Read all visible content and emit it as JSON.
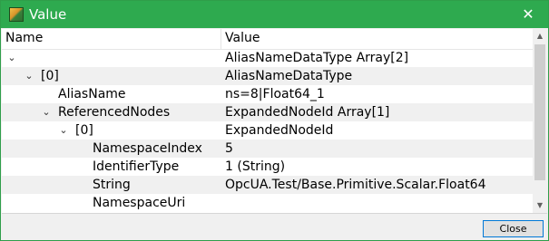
{
  "window": {
    "title": "Value",
    "close_glyph": "✕",
    "app_icon": "app-icon"
  },
  "tree": {
    "columns": {
      "name": "Name",
      "value": "Value"
    },
    "rows": [
      {
        "name": "",
        "value": "AliasNameDataType Array[2]",
        "expander": "⌄",
        "level": 0
      },
      {
        "name": "[0]",
        "value": "AliasNameDataType",
        "expander": "⌄",
        "level": 1
      },
      {
        "name": "AliasName",
        "value": "ns=8|Float64_1",
        "expander": "",
        "level": 2
      },
      {
        "name": "ReferencedNodes",
        "value": "ExpandedNodeId Array[1]",
        "expander": "⌄",
        "level": 2
      },
      {
        "name": "[0]",
        "value": "ExpandedNodeId",
        "expander": "⌄",
        "level": 3
      },
      {
        "name": "NamespaceIndex",
        "value": "5",
        "expander": "",
        "level": 4
      },
      {
        "name": "IdentifierType",
        "value": "1 (String)",
        "expander": "",
        "level": 4
      },
      {
        "name": "String",
        "value": "OpcUA.Test/Base.Primitive.Scalar.Float64",
        "expander": "",
        "level": 4
      },
      {
        "name": "NamespaceUri",
        "value": "",
        "expander": "",
        "level": 4
      }
    ]
  },
  "footer": {
    "close_label": "Close"
  },
  "colors": {
    "titlebar": "#2eaa4f",
    "alt_row": "#f0f0f0",
    "button_border": "#0078d7"
  }
}
